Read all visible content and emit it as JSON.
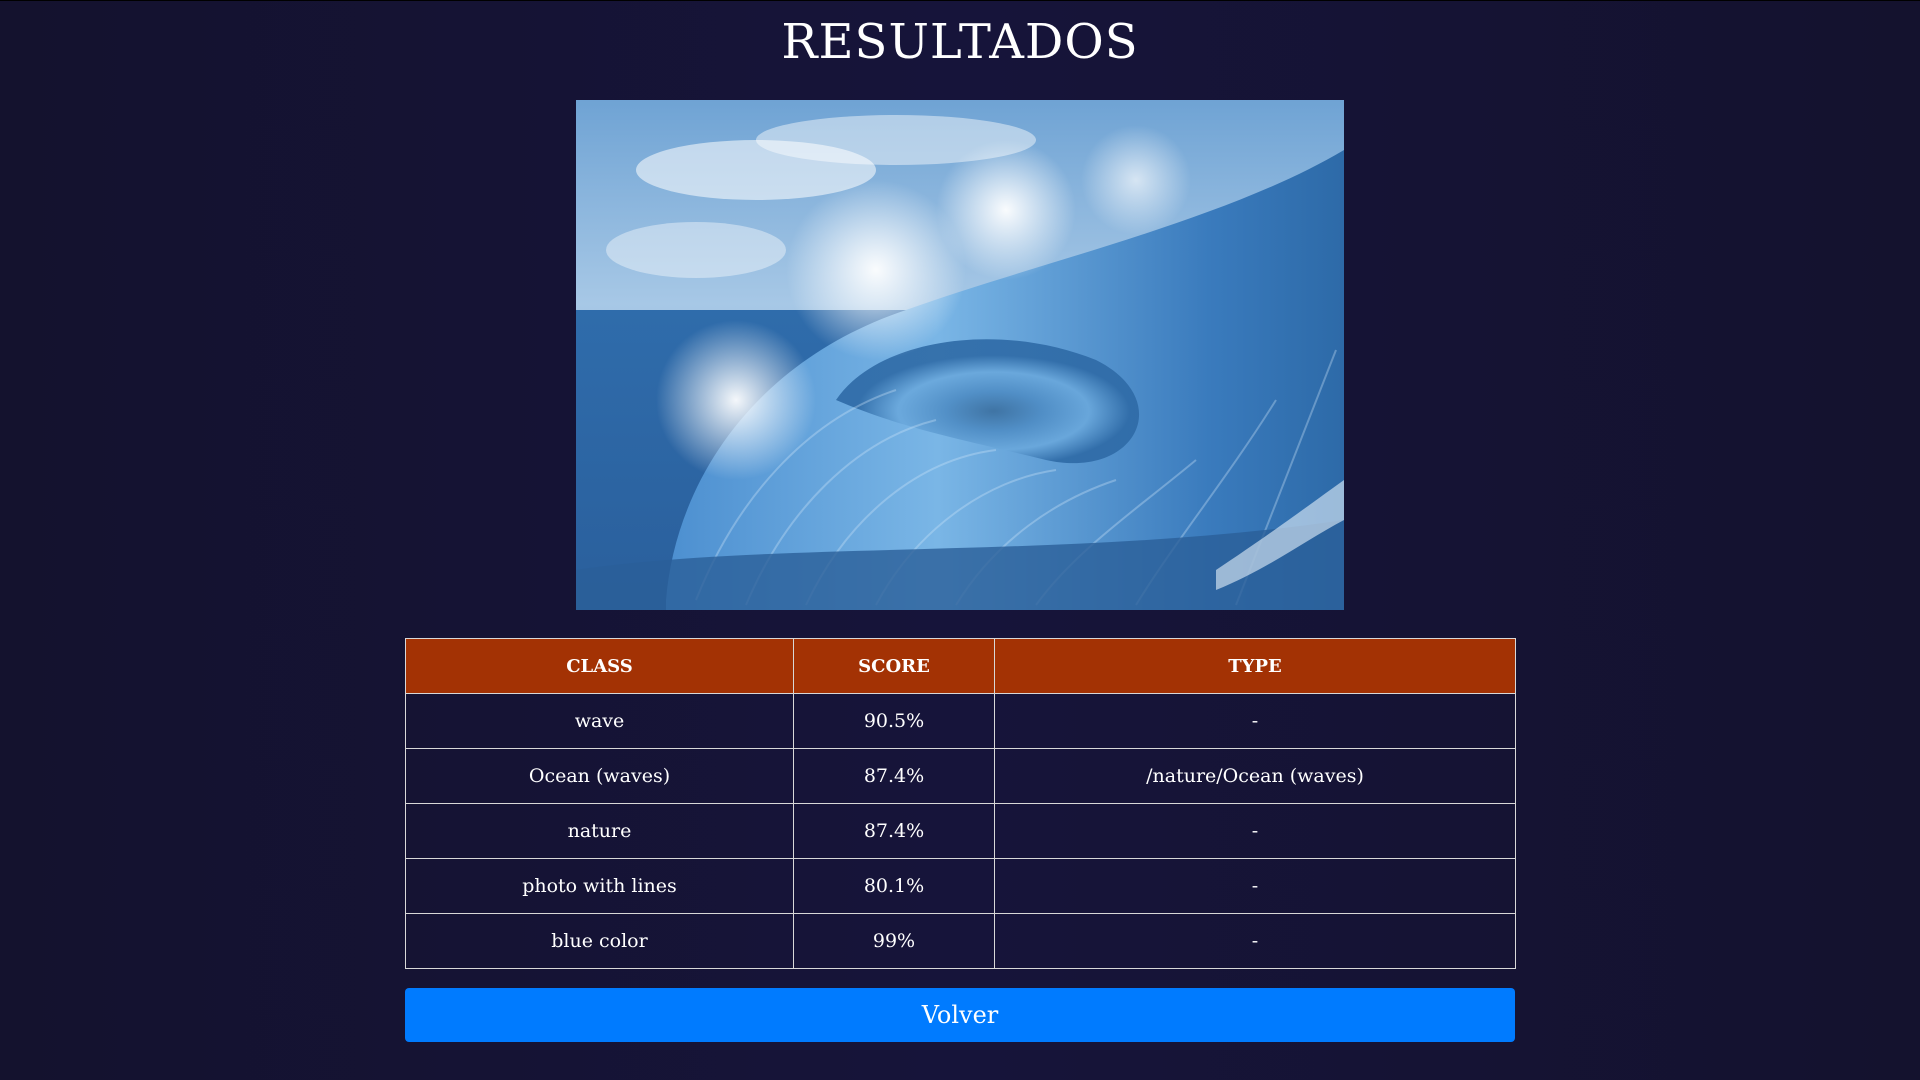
{
  "page": {
    "title": "RESULTADOS"
  },
  "image": {
    "subject": "ocean wave photo",
    "icon": "wave-photo"
  },
  "table": {
    "headers": [
      "CLASS",
      "SCORE",
      "TYPE"
    ],
    "rows": [
      {
        "class": "wave",
        "score": "90.5%",
        "type": "-"
      },
      {
        "class": "Ocean (waves)",
        "score": "87.4%",
        "type": "/nature/Ocean (waves)"
      },
      {
        "class": "nature",
        "score": "87.4%",
        "type": "-"
      },
      {
        "class": "photo with lines",
        "score": "80.1%",
        "type": "-"
      },
      {
        "class": "blue color",
        "score": "99%",
        "type": "-"
      }
    ]
  },
  "actions": {
    "back_label": "Volver"
  },
  "colors": {
    "background": "#15132f",
    "header_bg": "#a33204",
    "button_bg": "#007bff"
  }
}
